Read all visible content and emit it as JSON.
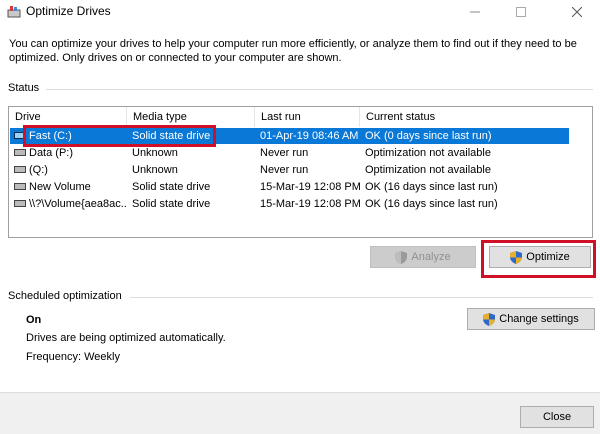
{
  "window": {
    "title": "Optimize Drives",
    "minimize_icon": "minimize-icon",
    "maximize_icon": "maximize-icon",
    "close_icon": "close-icon"
  },
  "description": "You can optimize your drives to help your computer run more efficiently, or analyze them to find out if they need to be optimized. Only drives on or connected to your computer are shown.",
  "status": {
    "section_label": "Status",
    "columns": [
      "Drive",
      "Media type",
      "Last run",
      "Current status"
    ],
    "rows": [
      {
        "drive": "Fast (C:)",
        "media": "Solid state drive",
        "last_run": "01-Apr-19 08:46 AM",
        "status": "OK (0 days since last run)",
        "selected": true
      },
      {
        "drive": "Data (P:)",
        "media": "Unknown",
        "last_run": "Never run",
        "status": "Optimization not available",
        "selected": false
      },
      {
        "drive": "(Q:)",
        "media": "Unknown",
        "last_run": "Never run",
        "status": "Optimization not available",
        "selected": false
      },
      {
        "drive": "New Volume",
        "media": "Solid state drive",
        "last_run": "15-Mar-19 12:08 PM",
        "status": "OK (16 days since last run)",
        "selected": false
      },
      {
        "drive": "\\\\?\\Volume{aea8ac...",
        "media": "Solid state drive",
        "last_run": "15-Mar-19 12:08 PM",
        "status": "OK (16 days since last run)",
        "selected": false
      }
    ]
  },
  "buttons": {
    "analyze": "Analyze",
    "optimize": "Optimize",
    "change_settings": "Change settings",
    "close": "Close"
  },
  "scheduled": {
    "section_label": "Scheduled optimization",
    "state": "On",
    "message": "Drives are being optimized automatically.",
    "frequency": "Frequency: Weekly"
  },
  "colors": {
    "selection": "#0a78d7",
    "highlight": "#d01025"
  }
}
